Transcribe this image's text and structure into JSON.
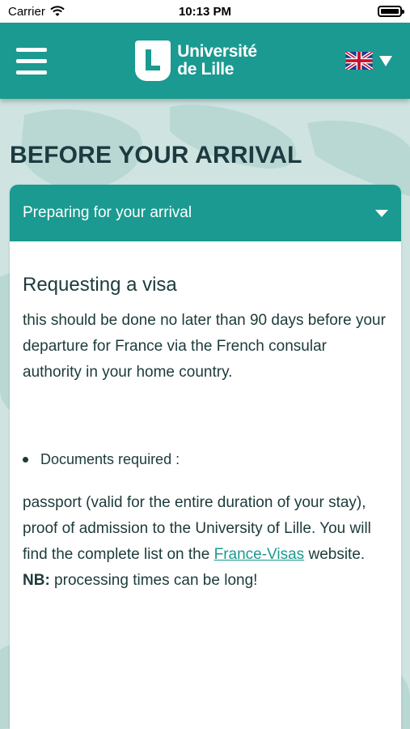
{
  "status_bar": {
    "carrier": "Carrier",
    "time": "10:13 PM"
  },
  "header": {
    "logo_line1": "Université",
    "logo_line2": "de Lille",
    "language_icon": "uk-flag-icon"
  },
  "page": {
    "title": "BEFORE YOUR ARRIVAL"
  },
  "accordion": {
    "title": "Preparing for your arrival"
  },
  "content": {
    "heading": "Requesting a visa",
    "paragraph1": "this should be done no later than 90 days before your departure for France via the French consular authority in your home country.",
    "bullet1": "Documents required :",
    "paragraph2_start": "passport (valid for the entire duration of your stay), proof of admission to the University of Lille. You will find the complete list on the ",
    "link_text": "France-Visas",
    "paragraph2_mid": " website. ",
    "nb_label": "NB:",
    "paragraph2_end": " processing times can be long!"
  },
  "colors": {
    "primary": "#1a9a90",
    "background": "#cfe4e1",
    "text": "#1d3a3a"
  }
}
